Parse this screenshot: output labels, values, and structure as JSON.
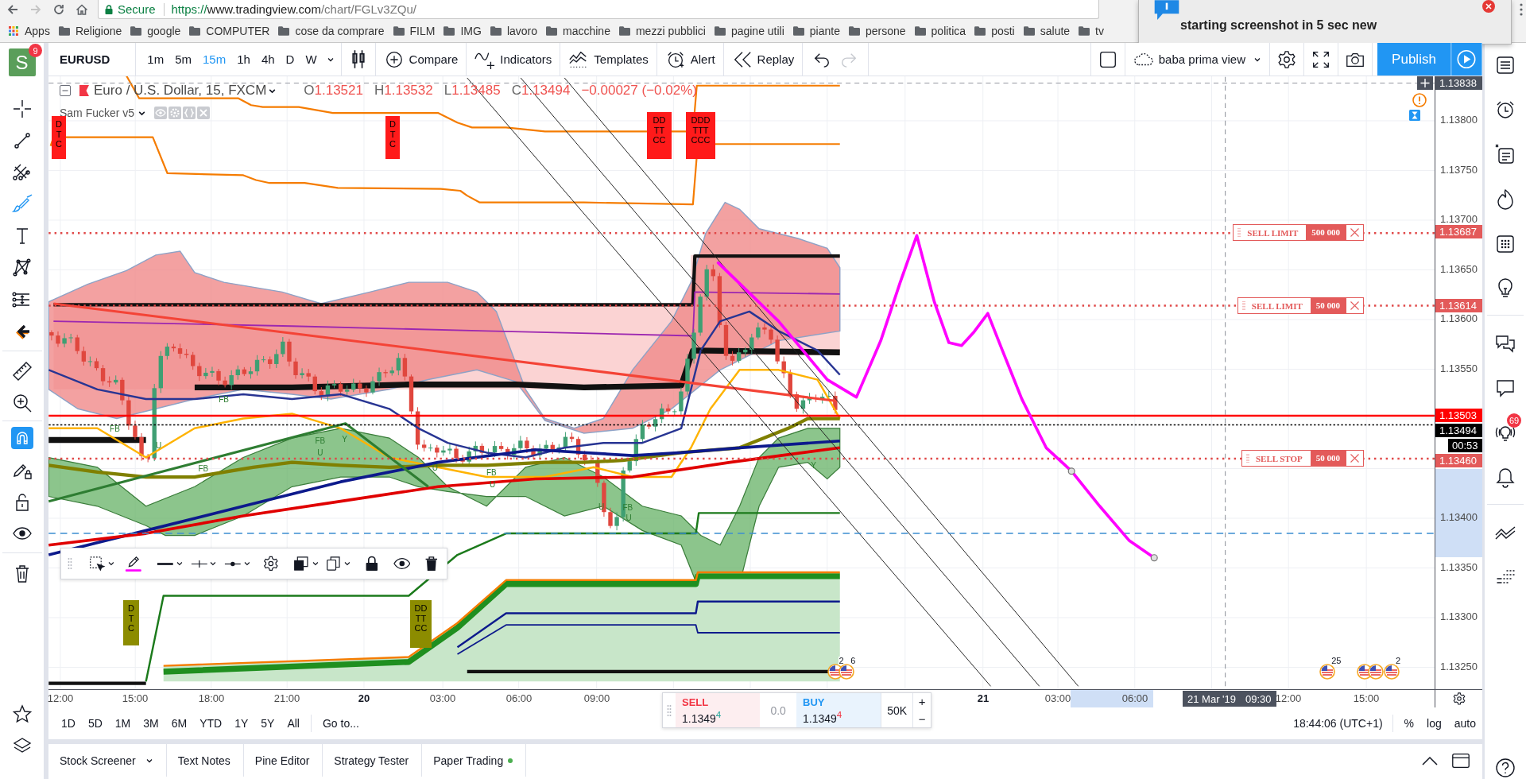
{
  "browser": {
    "secure": "Secure",
    "url": {
      "scheme": "https://",
      "host": "www.tradingview.com",
      "path": "/chart/FGLv3ZQu/"
    },
    "bookmarks": [
      {
        "label": "Apps",
        "kind": "apps"
      },
      {
        "label": "Religione",
        "kind": "folder"
      },
      {
        "label": "google",
        "kind": "folder"
      },
      {
        "label": "COMPUTER",
        "kind": "folder"
      },
      {
        "label": "cose da comprare",
        "kind": "folder"
      },
      {
        "label": "FILM",
        "kind": "folder"
      },
      {
        "label": "IMG",
        "kind": "folder"
      },
      {
        "label": "lavoro",
        "kind": "folder"
      },
      {
        "label": "macchine",
        "kind": "folder"
      },
      {
        "label": "mezzi pubblici",
        "kind": "folder"
      },
      {
        "label": "pagine utili",
        "kind": "folder"
      },
      {
        "label": "piante",
        "kind": "folder"
      },
      {
        "label": "persone",
        "kind": "folder"
      },
      {
        "label": "politica",
        "kind": "folder"
      },
      {
        "label": "posti",
        "kind": "folder"
      },
      {
        "label": "salute",
        "kind": "folder"
      },
      {
        "label": "tv",
        "kind": "folder"
      }
    ]
  },
  "notification": {
    "text": "starting screenshot in 5 sec new"
  },
  "toolbar": {
    "avatar": {
      "letter": "S",
      "badge": "9"
    },
    "symbol": "EURUSD",
    "intervals": [
      {
        "label": "1m",
        "selected": false
      },
      {
        "label": "5m",
        "selected": false
      },
      {
        "label": "15m",
        "selected": true
      },
      {
        "label": "1h",
        "selected": false
      },
      {
        "label": "4h",
        "selected": false
      },
      {
        "label": "D",
        "selected": false
      },
      {
        "label": "W",
        "selected": false
      }
    ],
    "actions": [
      {
        "label": "Compare",
        "kind": "compare"
      },
      {
        "label": "Indicators",
        "kind": "indicators"
      },
      {
        "label": "Templates",
        "kind": "templates"
      },
      {
        "label": "Alert",
        "kind": "alert"
      },
      {
        "label": "Replay",
        "kind": "replay"
      }
    ],
    "history": [
      {
        "kind": "undo",
        "disabled": false
      },
      {
        "kind": "redo",
        "disabled": true
      }
    ],
    "layout": "baba prima view",
    "publish": "Publish"
  },
  "left_toolbar": {
    "tools": [
      {
        "kind": "crosshair",
        "selected": false
      },
      {
        "kind": "trend_line",
        "selected": false
      },
      {
        "kind": "pitchfork",
        "selected": false
      },
      {
        "kind": "brush",
        "selected": true
      },
      {
        "kind": "text",
        "selected": false
      },
      {
        "kind": "pattern",
        "selected": false
      },
      {
        "kind": "prediction",
        "selected": false
      },
      {
        "kind": "arrow",
        "selected": false
      }
    ],
    "toggles": [
      {
        "kind": "magnet",
        "on": true
      },
      {
        "kind": "lock_drawing",
        "on": false
      },
      {
        "kind": "lock",
        "on": false
      },
      {
        "kind": "eye",
        "on": false
      }
    ]
  },
  "chart": {
    "header": {
      "title": "Euro / U.S. Dollar, 15, FXCM",
      "falling": true,
      "ohlc": [
        {
          "key": "O",
          "value": "1.13521"
        },
        {
          "key": "H",
          "value": "1.13532"
        },
        {
          "key": "L",
          "value": "1.13485"
        },
        {
          "key": "C",
          "value": "1.13494"
        }
      ],
      "change": "−0.00027 (−0.02%)"
    },
    "indicator": {
      "name": "Sam Fucker v5"
    },
    "signal_boxes": [
      {
        "text": "D T C",
        "color": "#ff1a1a"
      },
      {
        "text": "D T C",
        "color": "#ff1a1a"
      },
      {
        "text": "DD TT CC",
        "color": "#ff1a1a"
      },
      {
        "text": "DDD TTT CCC",
        "color": "#ff1a1a"
      },
      {
        "text": "D T C",
        "color": "#8c8c00"
      },
      {
        "text": "DD TT CC",
        "color": "#8c8c00"
      }
    ],
    "markers": [
      {
        "text": "FB"
      },
      {
        "text": "U"
      },
      {
        "text": "FB"
      },
      {
        "text": "FB"
      },
      {
        "text": "FB"
      },
      {
        "text": "U"
      },
      {
        "text": "Y"
      },
      {
        "text": "U"
      },
      {
        "text": "FB"
      },
      {
        "text": "U"
      },
      {
        "text": "U"
      },
      {
        "text": "FB"
      },
      {
        "text": "U"
      },
      {
        "text": "Y"
      }
    ],
    "orders": [
      {
        "type": "SELL LIMIT",
        "quantity": "500 000"
      },
      {
        "type": "SELL LIMIT",
        "quantity": "50 000"
      },
      {
        "type": "SELL STOP",
        "quantity": "50 000"
      }
    ],
    "events": [
      {
        "count": "2"
      },
      {
        "count": "6"
      },
      {
        "count": "25"
      },
      {
        "count": "2"
      }
    ]
  },
  "price_axis": {
    "ticks": [
      "1.13800",
      "1.13750",
      "1.13700",
      "1.13650",
      "1.13600",
      "1.13550",
      "1.13400",
      "1.13350",
      "1.13300",
      "1.13250"
    ],
    "markers": [
      {
        "label": "1.13838",
        "kind": "crosshair"
      },
      {
        "label": "1.13687",
        "kind": "order"
      },
      {
        "label": "1.13614",
        "kind": "order"
      },
      {
        "label": "1.13503",
        "kind": "line"
      },
      {
        "label": "1.13494",
        "kind": "last"
      },
      {
        "label": "00:53",
        "kind": "countdown"
      },
      {
        "label": "1.13460",
        "kind": "order"
      }
    ]
  },
  "time_axis": {
    "labels": [
      {
        "text": "12:00",
        "kind": "time"
      },
      {
        "text": "15:00",
        "kind": "time"
      },
      {
        "text": "18:00",
        "kind": "time"
      },
      {
        "text": "21:00",
        "kind": "time"
      },
      {
        "text": "20",
        "kind": "day"
      },
      {
        "text": "03:00",
        "kind": "time"
      },
      {
        "text": "06:00",
        "kind": "time"
      },
      {
        "text": "09:00",
        "kind": "time"
      },
      {
        "text": "21",
        "kind": "day"
      },
      {
        "text": "03:00",
        "kind": "time"
      },
      {
        "text": "06:00",
        "kind": "time"
      },
      {
        "text": "12:00",
        "kind": "time"
      },
      {
        "text": "15:00",
        "kind": "time"
      }
    ],
    "crosshair": {
      "date": "21 Mar '19",
      "time": "09:30"
    }
  },
  "trade_panel": {
    "sell": {
      "label": "SELL",
      "price": "1.1349$^{4}$"
    },
    "spread": "0.0",
    "buy": {
      "label": "BUY",
      "price": "1.1349$^{4}$"
    },
    "quantity": "50K",
    "plus": "+",
    "minus": "−"
  },
  "range_bar": {
    "ranges": [
      "1D",
      "5D",
      "1M",
      "3M",
      "6M",
      "YTD",
      "1Y",
      "5Y",
      "All"
    ],
    "goto": "Go to...",
    "clock": "18:44:06 (UTC+1)",
    "scale": [
      "%",
      "log",
      "auto"
    ]
  },
  "bottom_panel": {
    "tabs": [
      {
        "label": "Stock Screener",
        "dropdown": true,
        "online": false
      },
      {
        "label": "Text Notes",
        "dropdown": false,
        "online": false
      },
      {
        "label": "Pine Editor",
        "dropdown": false,
        "online": false
      },
      {
        "label": "Strategy Tester",
        "dropdown": false,
        "online": false
      },
      {
        "label": "Paper Trading",
        "dropdown": false,
        "online": true
      }
    ]
  },
  "right_sidebar": {
    "badge": "69"
  }
}
